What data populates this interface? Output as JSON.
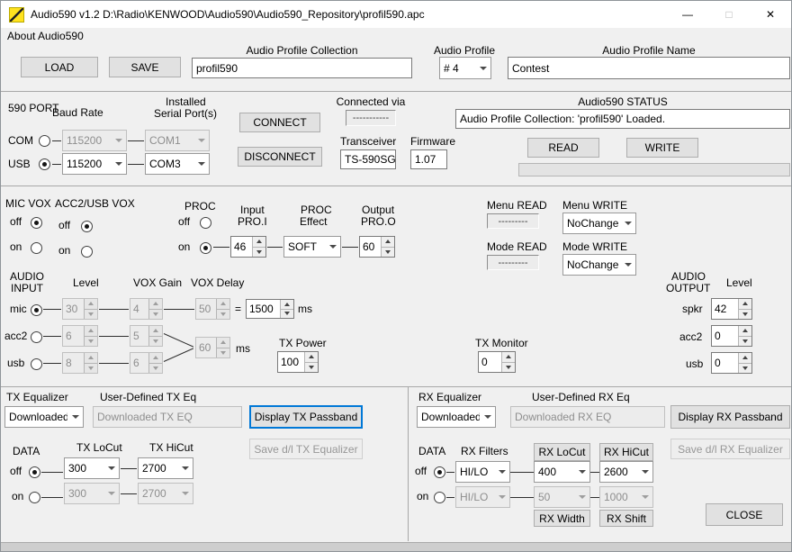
{
  "titlebar": {
    "title": "Audio590  v1.2  D:\\Radio\\KENWOOD\\Audio590\\Audio590_Repository\\profil590.apc",
    "minimize": "—",
    "maximize": "□",
    "close": "✕"
  },
  "menubar": {
    "about": "About Audio590"
  },
  "profile": {
    "load": "LOAD",
    "save": "SAVE",
    "collection_label": "Audio Profile Collection",
    "collection_value": "profil590",
    "profile_label": "Audio Profile",
    "profile_number": "# 4",
    "name_label": "Audio Profile Name",
    "name_value": "Contest"
  },
  "port": {
    "title": "590 PORT",
    "baud_label": "Baud Rate",
    "installed_label_1": "Installed",
    "installed_label_2": "Serial Port(s)",
    "com_label": "COM",
    "usb_label": "USB",
    "selected": "USB",
    "com_baud": "115200",
    "com_port": "COM1",
    "usb_baud": "115200",
    "usb_port": "COM3",
    "connect": "CONNECT",
    "disconnect": "DISCONNECT",
    "connected_via_label": "Connected via",
    "connected_via_value": "-----------",
    "transceiver_label": "Transceiver",
    "transceiver_value": "TS-590SG",
    "firmware_label": "Firmware",
    "firmware_value": "1.07",
    "status_label": "Audio590 STATUS",
    "status_value": "Audio Profile Collection: 'profil590'  Loaded.",
    "read": "READ",
    "write": "WRITE"
  },
  "vox": {
    "mic_vox_label": "MIC VOX",
    "acc2_vox_label": "ACC2/USB VOX",
    "off_label": "off",
    "on_label": "on",
    "mic_vox_state": "off",
    "acc2_vox_state": "off",
    "proc_label": "PROC",
    "proc_state": "on",
    "input_label_1": "Input",
    "input_label_2": "PRO.I",
    "effect_label_1": "PROC",
    "effect_label_2": "Effect",
    "output_label_1": "Output",
    "output_label_2": "PRO.O",
    "pro_input": "46",
    "proc_effect": "SOFT",
    "pro_output": "60"
  },
  "menu_mode": {
    "menu_read_label": "Menu READ",
    "menu_read_value": "---------",
    "menu_write_label": "Menu WRITE",
    "menu_write_value": "NoChange",
    "mode_read_label": "Mode READ",
    "mode_read_value": "---------",
    "mode_write_label": "Mode WRITE",
    "mode_write_value": "NoChange"
  },
  "audio_input": {
    "label_1": "AUDIO",
    "label_2": "INPUT",
    "level_label": "Level",
    "vox_gain_label": "VOX Gain",
    "vox_delay_label": "VOX Delay",
    "selected_input": "mic",
    "mic_label": "mic",
    "acc2_label": "acc2",
    "usb_label": "usb",
    "mic_level": "30",
    "mic_vox_gain": "4",
    "mic_vox_delay": "50",
    "equals": "=",
    "mic_delay_ms": "1500",
    "ms_label": "ms",
    "acc2_level": "6",
    "acc2_vox_gain": "5",
    "usb_level": "8",
    "usb_vox_gain": "6",
    "data_vox_delay": "60",
    "tx_power_label": "TX Power",
    "tx_power": "100",
    "tx_monitor_label": "TX Monitor",
    "tx_monitor": "0"
  },
  "audio_output": {
    "label_1": "AUDIO",
    "label_2": "OUTPUT",
    "level_label": "Level",
    "spkr_label": "spkr",
    "spkr_level": "42",
    "acc2_label": "acc2",
    "acc2_level": "0",
    "usb_label": "usb",
    "usb_level": "0"
  },
  "tx_eq": {
    "title": "TX Equalizer",
    "user_label": "User-Defined TX Eq",
    "eq_select": "Downloaded",
    "user_value": "Downloaded TX EQ",
    "display_button": "Display TX Passband",
    "save_button": "Save d/l TX Equalizer",
    "data_label": "DATA",
    "data_state": "off",
    "off_label": "off",
    "on_label": "on",
    "locut_label": "TX LoCut",
    "hicut_label": "TX HiCut",
    "locut_off": "300",
    "hicut_off": "2700",
    "locut_on": "300",
    "hicut_on": "2700"
  },
  "rx_eq": {
    "title": "RX Equalizer",
    "user_label": "User-Defined RX Eq",
    "eq_select": "Downloaded",
    "user_value": "Downloaded RX EQ",
    "display_button": "Display RX Passband",
    "save_button": "Save d/l RX Equalizer",
    "data_label": "DATA",
    "data_state": "off",
    "off_label": "off",
    "on_label": "on",
    "filters_label": "RX Filters",
    "locut_button": "RX LoCut",
    "hicut_button": "RX HiCut",
    "filters_off": "HI/LO",
    "locut_off": "400",
    "hicut_off": "2600",
    "filters_on": "HI/LO",
    "locut_on": "50",
    "hicut_on": "1000",
    "width_button": "RX Width",
    "shift_button": "RX Shift"
  },
  "footer": {
    "close": "CLOSE"
  }
}
